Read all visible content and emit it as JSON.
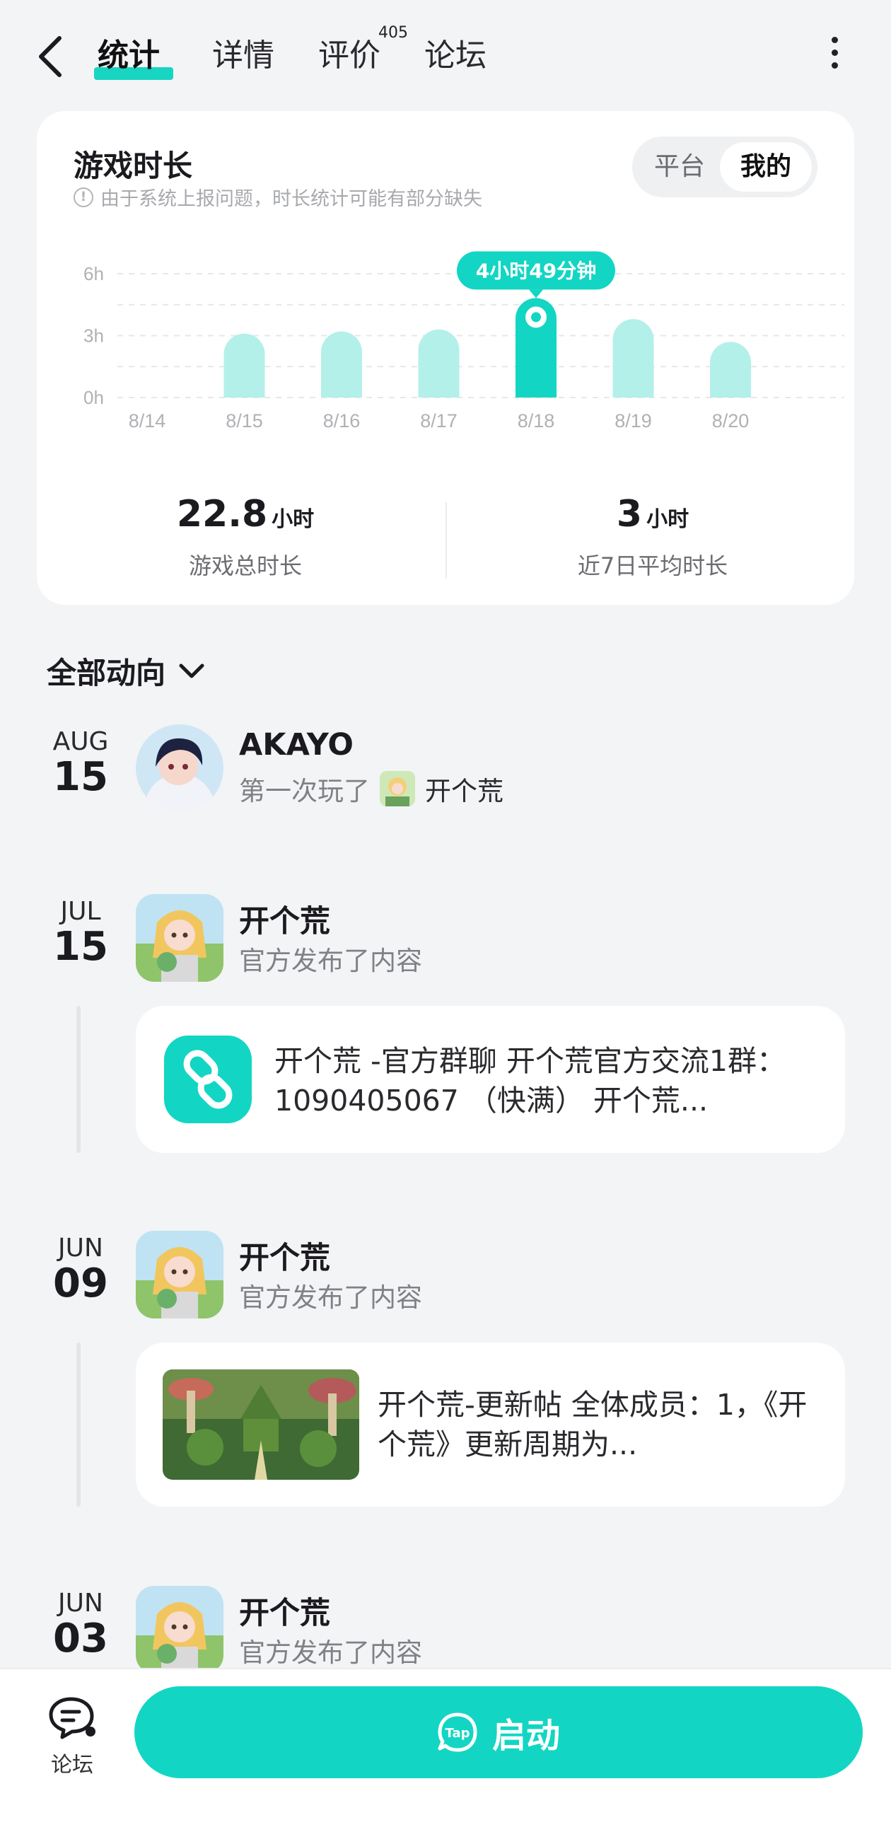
{
  "nav": {
    "tabs": [
      "统计",
      "详情",
      "评价",
      "论坛"
    ],
    "review_count": "405"
  },
  "stats": {
    "title": "游戏时长",
    "note": "由于系统上报问题，时长统计可能有部分缺失",
    "toggle": [
      "平台",
      "我的"
    ],
    "total_value": "22.8",
    "total_unit": "小时",
    "total_label": "游戏总时长",
    "avg_value": "3",
    "avg_unit": "小时",
    "avg_label": "近7日平均时长"
  },
  "chart_data": {
    "type": "bar",
    "categories": [
      "8/14",
      "8/15",
      "8/16",
      "8/17",
      "8/18",
      "8/19",
      "8/20"
    ],
    "values": [
      0,
      3.1,
      3.2,
      3.3,
      4.82,
      3.8,
      2.7
    ],
    "highlight_index": 4,
    "highlight_label": "4小时49分钟",
    "y_ticks": [
      "6h",
      "3h",
      "0h"
    ],
    "ylim": [
      0,
      6
    ],
    "grid": true,
    "colors": {
      "bar": "#b3f0ea",
      "highlight": "#12d6c3"
    }
  },
  "feed": {
    "filter_label": "全部动向",
    "entries": [
      {
        "month": "AUG",
        "day": "15",
        "name": "AKAYO",
        "action": "第一次玩了",
        "game": "开个荒"
      },
      {
        "month": "JUL",
        "day": "15",
        "name": "开个荒",
        "action": "官方发布了内容",
        "post": "开个荒 -官方群聊 开个荒官方交流1群：1090405067 （快满） 开个荒..."
      },
      {
        "month": "JUN",
        "day": "09",
        "name": "开个荒",
        "action": "官方发布了内容",
        "post": "开个荒-更新帖 全体成员：1，《开个荒》更新周期为..."
      },
      {
        "month": "JUN",
        "day": "03",
        "name": "开个荒",
        "action": "官方发布了内容"
      }
    ]
  },
  "bottom": {
    "forum_label": "论坛",
    "launch_label": "启动",
    "launch_badge": "Tap"
  }
}
